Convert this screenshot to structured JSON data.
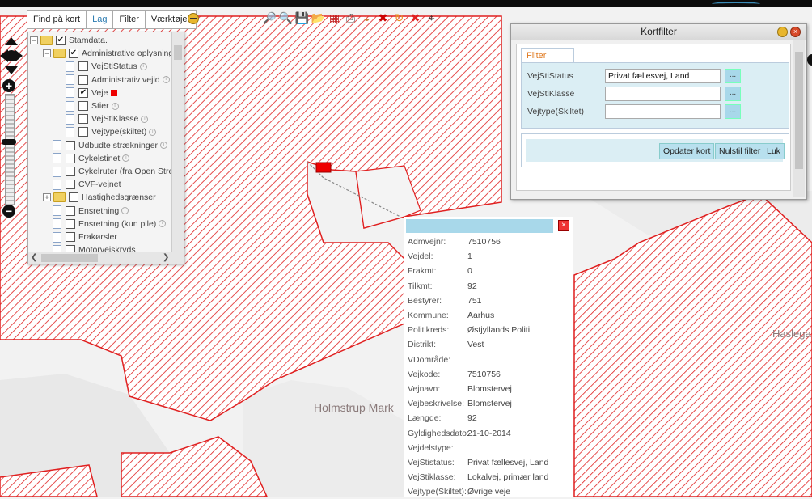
{
  "toolbar": {
    "tabs": [
      {
        "label": "Find på kort",
        "active": false
      },
      {
        "label": "Lag",
        "active": true
      },
      {
        "label": "Filter",
        "active": false
      },
      {
        "label": "Værktøjer",
        "active": false
      }
    ],
    "tool_icons": [
      "zoom-in-icon",
      "zoom-out-icon",
      "save-icon",
      "open-folder-icon",
      "grid-icon",
      "print-icon",
      "palette-icon",
      "bug-icon",
      "refresh-icon",
      "delete-icon",
      "crosshair-icon"
    ]
  },
  "map": {
    "place_labels": [
      "Holmstrup Mark",
      "Haslega"
    ],
    "hatch_color": "#e02020"
  },
  "layers": {
    "items": [
      {
        "label": "Stamdata.",
        "checked": true,
        "expander": "−",
        "folder": true,
        "level": 0
      },
      {
        "label": "Administrative oplysninger",
        "checked": true,
        "expander": "−",
        "folder": true,
        "level": 1
      },
      {
        "label": "VejStiStatus",
        "checked": false,
        "level": 2,
        "info": true
      },
      {
        "label": "Administrativ vejid",
        "checked": false,
        "level": 2,
        "info": true
      },
      {
        "label": "Veje",
        "checked": true,
        "level": 2,
        "swatch": true
      },
      {
        "label": "Stier",
        "checked": false,
        "level": 2,
        "info": true
      },
      {
        "label": "VejStiKlasse",
        "checked": false,
        "level": 2,
        "info": true
      },
      {
        "label": "Vejtype(skiltet)",
        "checked": false,
        "level": 2,
        "info": true
      },
      {
        "label": "Udbudte strækninger",
        "checked": false,
        "level": 1,
        "info": true
      },
      {
        "label": "Cykelstinet",
        "checked": false,
        "level": 1,
        "info": true
      },
      {
        "label": "Cykelruter (fra Open Stre",
        "checked": false,
        "level": 1
      },
      {
        "label": "CVF-vejnet",
        "checked": false,
        "level": 1
      },
      {
        "label": "Hastighedsgrænser",
        "checked": false,
        "expander": "+",
        "folder": true,
        "level": 1
      },
      {
        "label": "Ensretning",
        "checked": false,
        "level": 1,
        "info": true
      },
      {
        "label": "Ensretning (kun pile)",
        "checked": false,
        "level": 1,
        "info": true
      },
      {
        "label": "Frakørsler",
        "checked": false,
        "level": 1
      },
      {
        "label": "Motorvejskryds",
        "checked": false,
        "level": 1
      }
    ]
  },
  "kortfilter": {
    "title": "Kortfilter",
    "tab_label": "Filter",
    "fields": [
      {
        "label": "VejStiStatus",
        "value": "Privat fællesvej, Land",
        "button": "..."
      },
      {
        "label": "VejStiKlasse",
        "value": "",
        "button": "..."
      },
      {
        "label": "Vejtype(Skiltet)",
        "value": "",
        "button": "..."
      }
    ],
    "buttons": {
      "update": "Opdater kort",
      "reset": "Nulstil filter",
      "close": "Luk"
    }
  },
  "feature_info": {
    "rows": [
      {
        "key": "Admvejnr:",
        "value": "7510756"
      },
      {
        "key": "Vejdel:",
        "value": "1"
      },
      {
        "key": "Frakmt:",
        "value": "0"
      },
      {
        "key": "Tilkmt:",
        "value": "92"
      },
      {
        "key": "Bestyrer:",
        "value": "751"
      },
      {
        "key": "Kommune:",
        "value": "Aarhus"
      },
      {
        "key": "Politikreds:",
        "value": "Østjyllands Politi"
      },
      {
        "key": "Distrikt:",
        "value": "Vest"
      },
      {
        "key": "VDområde:",
        "value": ""
      },
      {
        "key": "Vejkode:",
        "value": "7510756"
      },
      {
        "key": "Vejnavn:",
        "value": "Blomstervej"
      },
      {
        "key": "Vejbeskrivelse:",
        "value": "Blomstervej"
      },
      {
        "key": "Længde:",
        "value": "92"
      },
      {
        "key": "Gyldighedsdato:",
        "value": "21-10-2014"
      },
      {
        "key": "Vejdelstype:",
        "value": ""
      },
      {
        "key": "VejStistatus:",
        "value": "Privat fællesvej, Land"
      },
      {
        "key": "VejStiklasse:",
        "value": "Lokalvej, primær land"
      },
      {
        "key": "Vejtype(Skiltet):",
        "value": "Øvrige veje"
      }
    ]
  }
}
